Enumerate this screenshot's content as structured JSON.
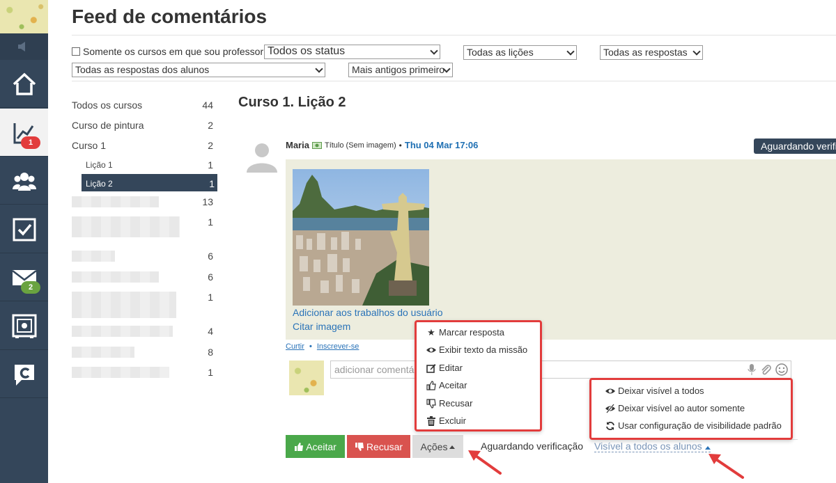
{
  "page": {
    "title": "Feed de comentários"
  },
  "sidebar": {
    "items": [
      {
        "name": "home",
        "icon": "home-icon"
      },
      {
        "name": "progress",
        "icon": "chart-icon",
        "badge": "1",
        "badge_color": "#e23c3c"
      },
      {
        "name": "users",
        "icon": "users-icon"
      },
      {
        "name": "tasks",
        "icon": "checkbox-icon"
      },
      {
        "name": "messages",
        "icon": "envelope-icon",
        "badge": "2",
        "badge_color": "#6aa340"
      },
      {
        "name": "vault",
        "icon": "safe-icon"
      },
      {
        "name": "brand",
        "icon": "c-logo-icon"
      }
    ]
  },
  "filters": {
    "only_my_courses": "Somente os cursos em que sou professor",
    "status": "Todos os status",
    "lessons": "Todas as lições",
    "answers": "Todas as respostas",
    "student_answers": "Todas as respostas dos alunos",
    "order": "Mais antigos primeiro"
  },
  "courses": [
    {
      "name": "Todos os cursos",
      "count": "44"
    },
    {
      "name": "Curso de pintura",
      "count": "2"
    },
    {
      "name": "Curso 1",
      "count": "2"
    },
    {
      "name": "Lição 1",
      "count": "1"
    },
    {
      "name": "Lição 2",
      "count": "1"
    },
    {
      "name": "",
      "count": "13"
    },
    {
      "name": "",
      "count": "1"
    },
    {
      "name": "",
      "count": "6"
    },
    {
      "name": "",
      "count": "6"
    },
    {
      "name": "",
      "count": "1"
    },
    {
      "name": "",
      "count": "4"
    },
    {
      "name": "",
      "count": "8"
    },
    {
      "name": "",
      "count": "1"
    }
  ],
  "main": {
    "lesson_title": "Curso 1. Lição 2",
    "post": {
      "author": "Maria",
      "title": "Título (Sem imagem)",
      "separator": "•",
      "date": "Thu 04 Mar 17:06",
      "status": "Aguardando verificação",
      "add_to_works": "Adicionar aos trabalhos do usuário",
      "quote_image": "Citar imagem",
      "like": "Curtir",
      "subscribe": "Inscrever-se"
    },
    "comment_placeholder": "adicionar comentário"
  },
  "actions_menu": [
    {
      "label": "Marcar resposta",
      "icon": "star-icon"
    },
    {
      "label": "Exibir texto da missão",
      "icon": "eye-icon"
    },
    {
      "label": "Editar",
      "icon": "edit-icon"
    },
    {
      "label": "Aceitar",
      "icon": "thumbs-up-icon"
    },
    {
      "label": "Recusar",
      "icon": "thumbs-down-icon"
    },
    {
      "label": "Excluir",
      "icon": "trash-icon"
    }
  ],
  "visibility_menu": [
    {
      "label": "Deixar visível a todos",
      "icon": "eye-icon"
    },
    {
      "label": "Deixar visível ao autor somente",
      "icon": "eye-slash-icon"
    },
    {
      "label": "Usar configuração de visibilidade padrão",
      "icon": "refresh-icon"
    }
  ],
  "buttons": {
    "accept": "Aceitar",
    "reject": "Recusar",
    "actions": "Ações",
    "awaiting": "Aguardando verificação",
    "visibility": "Visível a todos os alunos"
  },
  "colors": {
    "sidebar": "#34465a",
    "accept": "#4aa84a",
    "reject": "#d9534f",
    "link": "#2a73b8",
    "highlight": "#e23c3c"
  }
}
